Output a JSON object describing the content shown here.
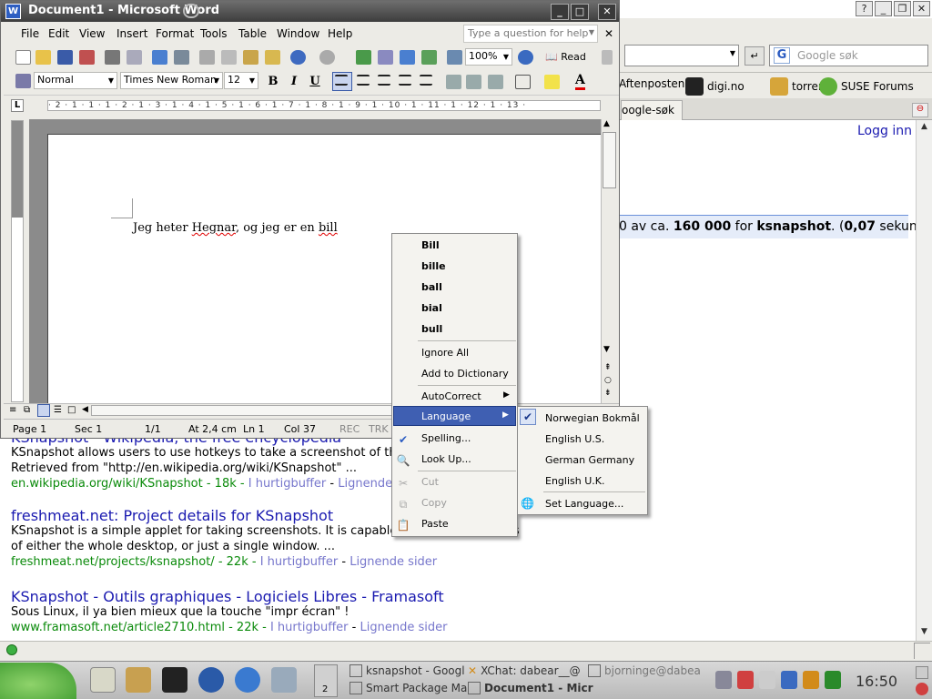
{
  "browser": {
    "search_placeholder": "Google søk",
    "bookmarks": [
      "Aftenposten",
      "digi.no",
      "torrents",
      "SUSE Forums"
    ],
    "tab_label": "oogle-søk",
    "login_link": "Logg inn",
    "result_stats": {
      "prefix": "0 av ca. ",
      "count": "160 000",
      "for": " for ",
      "query": "ksnapshot",
      "time_prefix": ". (",
      "time": "0,07",
      "time_suffix": " sekunder)"
    },
    "results": [
      {
        "title": "KSnapshot - Wikipedia, the free encyclopedia",
        "snippet1": "KSnapshot allows users to use hotkeys to take a screenshot of th",
        "snippet2": "Retrieved from \"http://en.wikipedia.org/wiki/KSnapshot\" ...",
        "url": "en.wikipedia.org/wiki/KSnapshot - 18k -",
        "cache": "I hurtigbuffer",
        "similar": "Lignende s"
      },
      {
        "title": "freshmeat.net: Project details for KSnapshot",
        "snippet1": "KSnapshot is a simple applet for taking screenshots. It is capable of capturing images",
        "snippet2": "of either the whole desktop, or just a single window. ...",
        "url": "freshmeat.net/projects/ksnapshot/ - 22k -",
        "cache": "I hurtigbuffer",
        "similar": "Lignende sider"
      },
      {
        "title": "KSnapshot - Outils graphiques - Logiciels Libres - Framasoft",
        "snippet1": "Sous Linux, il ya bien mieux que la touche \"impr écran\" !",
        "snippet2": "",
        "url": "www.framasoft.net/article2710.html - 22k -",
        "cache": "I hurtigbuffer",
        "similar": "Lignende sider"
      }
    ]
  },
  "word": {
    "title": "Document1 - Microsoft Word",
    "menu": [
      "File",
      "Edit",
      "View",
      "Insert",
      "Format",
      "Tools",
      "Table",
      "Window",
      "Help"
    ],
    "ask_placeholder": "Type a question for help",
    "zoom": "100%",
    "read_label": "Read",
    "style": "Normal",
    "font": "Times New Roman",
    "size": "12",
    "ruler_text": "· 2 · 1 · 1 · 1 · 2 · 1 · 3 · 1 · 4 · 1 · 5 · 1 · 6 · 1 · 7 · 1 · 8 · 1 · 9 · 1 · 10 · 1 · 11 · 1 · 12 · 1 · 13 ·",
    "doc": {
      "w1": "Jeg heter ",
      "w2": "Hegnar",
      "w3": ", og jeg er en ",
      "w4": "bill"
    },
    "status": {
      "page": "Page 1",
      "sec": "Sec 1",
      "pages": "1/1",
      "at": "At 2,4 cm",
      "ln": "Ln 1",
      "col": "Col 37",
      "rec": "REC",
      "trk": "TRK"
    }
  },
  "context_menu": {
    "suggestions": [
      "Bill",
      "bille",
      "ball",
      "bial",
      "bull"
    ],
    "ignore_all": "Ignore All",
    "add_dict": "Add to Dictionary",
    "autocorrect": "AutoCorrect",
    "language": "Language",
    "spelling": "Spelling...",
    "lookup": "Look Up...",
    "cut": "Cut",
    "copy": "Copy",
    "paste": "Paste"
  },
  "language_submenu": [
    "Norwegian Bokmål",
    "English U.S.",
    "German Germany",
    "English U.K.",
    "Set Language..."
  ],
  "taskbar": {
    "pager": "2",
    "tasks": [
      {
        "label": "ksnapshot - Googl"
      },
      {
        "label": "XChat: dabear__@"
      },
      {
        "label": "bjorninge@dabea"
      },
      {
        "label": "Smart Package Ma"
      },
      {
        "label": "Document1 - Micr"
      }
    ],
    "clock": "16:50"
  }
}
